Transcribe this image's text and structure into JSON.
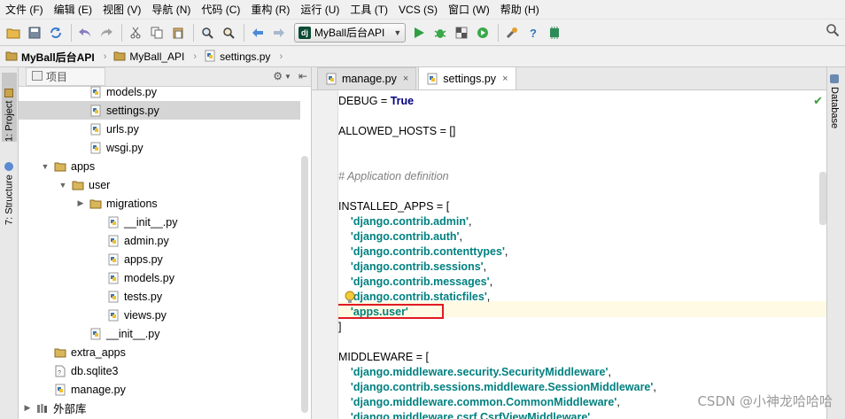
{
  "menu": [
    "文件 (F)",
    "编辑 (E)",
    "视图 (V)",
    "导航 (N)",
    "代码 (C)",
    "重构 (R)",
    "运行 (U)",
    "工具 (T)",
    "VCS (S)",
    "窗口 (W)",
    "帮助 (H)"
  ],
  "toolbar": {
    "run_config": "MyBall后台API",
    "run_config_badge": "dj"
  },
  "breadcrumb": [
    "MyBall后台API",
    "MyBall_API",
    "settings.py"
  ],
  "left_strip": {
    "project_tab": "1: Project",
    "structure_tab": "7: Structure"
  },
  "right_strip": {
    "database_tab": "Database"
  },
  "project_panel": {
    "view_label": "项目",
    "tree": [
      {
        "label": "models.py",
        "type": "py",
        "depth": 3,
        "arrow": ""
      },
      {
        "label": "settings.py",
        "type": "py",
        "depth": 3,
        "arrow": "",
        "selected": true
      },
      {
        "label": "urls.py",
        "type": "py",
        "depth": 3,
        "arrow": ""
      },
      {
        "label": "wsgi.py",
        "type": "py",
        "depth": 3,
        "arrow": ""
      },
      {
        "label": "apps",
        "type": "folder",
        "depth": 1,
        "arrow": "▼"
      },
      {
        "label": "user",
        "type": "folder",
        "depth": 2,
        "arrow": "▼"
      },
      {
        "label": "migrations",
        "type": "folder",
        "depth": 3,
        "arrow": "▶"
      },
      {
        "label": "__init__.py",
        "type": "py",
        "depth": 4,
        "arrow": ""
      },
      {
        "label": "admin.py",
        "type": "py",
        "depth": 4,
        "arrow": ""
      },
      {
        "label": "apps.py",
        "type": "py",
        "depth": 4,
        "arrow": ""
      },
      {
        "label": "models.py",
        "type": "py",
        "depth": 4,
        "arrow": ""
      },
      {
        "label": "tests.py",
        "type": "py",
        "depth": 4,
        "arrow": ""
      },
      {
        "label": "views.py",
        "type": "py",
        "depth": 4,
        "arrow": ""
      },
      {
        "label": "__init__.py",
        "type": "py",
        "depth": 3,
        "arrow": ""
      },
      {
        "label": "extra_apps",
        "type": "folder",
        "depth": 1,
        "arrow": ""
      },
      {
        "label": "db.sqlite3",
        "type": "file",
        "depth": 1,
        "arrow": ""
      },
      {
        "label": "manage.py",
        "type": "py",
        "depth": 1,
        "arrow": ""
      },
      {
        "label": "外部库",
        "type": "lib",
        "depth": 0,
        "arrow": "▶"
      }
    ]
  },
  "editor": {
    "tabs": [
      {
        "label": "manage.py",
        "active": false
      },
      {
        "label": "settings.py",
        "active": true
      }
    ],
    "tab_close": "×",
    "lines": [
      {
        "parts": [
          {
            "t": "DEBUG = ",
            "c": ""
          },
          {
            "t": "True",
            "c": "kw"
          }
        ]
      },
      {
        "parts": []
      },
      {
        "parts": [
          {
            "t": "ALLOWED_HOSTS = []",
            "c": ""
          }
        ]
      },
      {
        "parts": []
      },
      {
        "parts": []
      },
      {
        "parts": [
          {
            "t": "# Application definition",
            "c": "cmt"
          }
        ]
      },
      {
        "parts": []
      },
      {
        "parts": [
          {
            "t": "INSTALLED_APPS = [",
            "c": ""
          }
        ]
      },
      {
        "parts": [
          {
            "t": "    ",
            "c": ""
          },
          {
            "t": "'django.contrib.admin'",
            "c": "str"
          },
          {
            "t": ",",
            "c": ""
          }
        ]
      },
      {
        "parts": [
          {
            "t": "    ",
            "c": ""
          },
          {
            "t": "'django.contrib.auth'",
            "c": "str"
          },
          {
            "t": ",",
            "c": ""
          }
        ]
      },
      {
        "parts": [
          {
            "t": "    ",
            "c": ""
          },
          {
            "t": "'django.contrib.contenttypes'",
            "c": "str"
          },
          {
            "t": ",",
            "c": ""
          }
        ]
      },
      {
        "parts": [
          {
            "t": "    ",
            "c": ""
          },
          {
            "t": "'django.contrib.sessions'",
            "c": "str"
          },
          {
            "t": ",",
            "c": ""
          }
        ]
      },
      {
        "parts": [
          {
            "t": "    ",
            "c": ""
          },
          {
            "t": "'django.contrib.messages'",
            "c": "str"
          },
          {
            "t": ",",
            "c": ""
          }
        ]
      },
      {
        "parts": [
          {
            "t": "    ",
            "c": ""
          },
          {
            "t": "'django.contrib.staticfiles'",
            "c": "str"
          },
          {
            "t": ",",
            "c": ""
          }
        ]
      },
      {
        "parts": [
          {
            "t": "    ",
            "c": ""
          },
          {
            "t": "'apps.user'",
            "c": "str"
          }
        ]
      },
      {
        "parts": [
          {
            "t": "]",
            "c": ""
          }
        ]
      },
      {
        "parts": []
      },
      {
        "parts": [
          {
            "t": "MIDDLEWARE = [",
            "c": ""
          }
        ]
      },
      {
        "parts": [
          {
            "t": "    ",
            "c": ""
          },
          {
            "t": "'django.middleware.security.SecurityMiddleware'",
            "c": "str"
          },
          {
            "t": ",",
            "c": ""
          }
        ]
      },
      {
        "parts": [
          {
            "t": "    ",
            "c": ""
          },
          {
            "t": "'django.contrib.sessions.middleware.SessionMiddleware'",
            "c": "str"
          },
          {
            "t": ",",
            "c": ""
          }
        ]
      },
      {
        "parts": [
          {
            "t": "    ",
            "c": ""
          },
          {
            "t": "'django.middleware.common.CommonMiddleware'",
            "c": "str"
          },
          {
            "t": ",",
            "c": ""
          }
        ]
      },
      {
        "parts": [
          {
            "t": "    ",
            "c": ""
          },
          {
            "t": "'django.middleware.csrf.CsrfViewMiddleware'",
            "c": "str"
          },
          {
            "t": ",",
            "c": ""
          }
        ]
      }
    ]
  },
  "watermark": "CSDN @小神龙哈哈哈",
  "colors": {
    "keyword": "#000080",
    "string": "#008080",
    "comment": "#808080",
    "highlight_box": "#e01b24",
    "selection": "#d5d5d5"
  }
}
